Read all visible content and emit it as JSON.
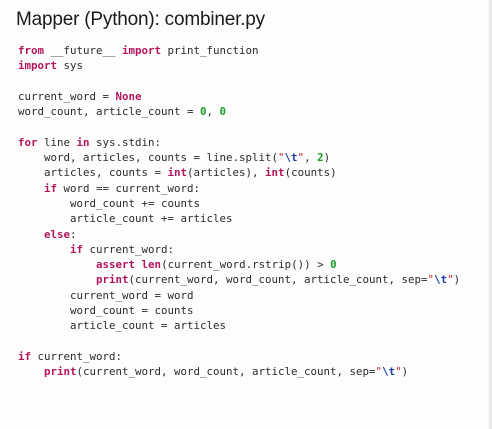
{
  "title": "Mapper (Python): combiner.py",
  "code_lines": [
    [
      {
        "t": "from",
        "k": "kw"
      },
      {
        "t": " __future__ ",
        "k": "txt"
      },
      {
        "t": "import",
        "k": "kw"
      },
      {
        "t": " print_function",
        "k": "txt"
      }
    ],
    [
      {
        "t": "import",
        "k": "kw"
      },
      {
        "t": " sys",
        "k": "txt"
      }
    ],
    [],
    [
      {
        "t": "current_word = ",
        "k": "txt"
      },
      {
        "t": "None",
        "k": "kw"
      }
    ],
    [
      {
        "t": "word_count, article_count = ",
        "k": "txt"
      },
      {
        "t": "0",
        "k": "num"
      },
      {
        "t": ", ",
        "k": "txt"
      },
      {
        "t": "0",
        "k": "num"
      }
    ],
    [],
    [
      {
        "t": "for",
        "k": "kw"
      },
      {
        "t": " line ",
        "k": "txt"
      },
      {
        "t": "in",
        "k": "kw"
      },
      {
        "t": " sys.stdin:",
        "k": "txt"
      }
    ],
    [
      {
        "t": "    word, articles, counts = line.split(",
        "k": "txt"
      },
      {
        "t": "\"",
        "k": "str"
      },
      {
        "t": "\\t",
        "k": "esc"
      },
      {
        "t": "\"",
        "k": "str"
      },
      {
        "t": ", ",
        "k": "txt"
      },
      {
        "t": "2",
        "k": "num"
      },
      {
        "t": ")",
        "k": "txt"
      }
    ],
    [
      {
        "t": "    articles, counts = ",
        "k": "txt"
      },
      {
        "t": "int",
        "k": "bi"
      },
      {
        "t": "(articles), ",
        "k": "txt"
      },
      {
        "t": "int",
        "k": "bi"
      },
      {
        "t": "(counts)",
        "k": "txt"
      }
    ],
    [
      {
        "t": "    ",
        "k": "txt"
      },
      {
        "t": "if",
        "k": "kw"
      },
      {
        "t": " word == current_word:",
        "k": "txt"
      }
    ],
    [
      {
        "t": "        word_count += counts",
        "k": "txt"
      }
    ],
    [
      {
        "t": "        article_count += articles",
        "k": "txt"
      }
    ],
    [
      {
        "t": "    ",
        "k": "txt"
      },
      {
        "t": "else",
        "k": "kw"
      },
      {
        "t": ":",
        "k": "txt"
      }
    ],
    [
      {
        "t": "        ",
        "k": "txt"
      },
      {
        "t": "if",
        "k": "kw"
      },
      {
        "t": " current_word:",
        "k": "txt"
      }
    ],
    [
      {
        "t": "            ",
        "k": "txt"
      },
      {
        "t": "assert",
        "k": "kw"
      },
      {
        "t": " ",
        "k": "txt"
      },
      {
        "t": "len",
        "k": "bi"
      },
      {
        "t": "(current_word.rstrip()) > ",
        "k": "txt"
      },
      {
        "t": "0",
        "k": "num"
      }
    ],
    [
      {
        "t": "            ",
        "k": "txt"
      },
      {
        "t": "print",
        "k": "bi"
      },
      {
        "t": "(current_word, word_count, article_count, sep=",
        "k": "txt"
      },
      {
        "t": "\"",
        "k": "str"
      },
      {
        "t": "\\t",
        "k": "esc"
      },
      {
        "t": "\"",
        "k": "str"
      },
      {
        "t": ")",
        "k": "txt"
      }
    ],
    [
      {
        "t": "        current_word = word",
        "k": "txt"
      }
    ],
    [
      {
        "t": "        word_count = counts",
        "k": "txt"
      }
    ],
    [
      {
        "t": "        article_count = articles",
        "k": "txt"
      }
    ],
    [],
    [
      {
        "t": "if",
        "k": "kw"
      },
      {
        "t": " current_word:",
        "k": "txt"
      }
    ],
    [
      {
        "t": "    ",
        "k": "txt"
      },
      {
        "t": "print",
        "k": "bi"
      },
      {
        "t": "(current_word, word_count, article_count, sep=",
        "k": "txt"
      },
      {
        "t": "\"",
        "k": "str"
      },
      {
        "t": "\\t",
        "k": "esc"
      },
      {
        "t": "\"",
        "k": "str"
      },
      {
        "t": ")",
        "k": "txt"
      }
    ]
  ],
  "colors": {
    "keyword": "#b3155c",
    "number": "#1a9c2b",
    "string": "#c8242b",
    "escape": "#1a3fa8",
    "text": "#2b2b2b",
    "title": "#1b1b1b"
  }
}
